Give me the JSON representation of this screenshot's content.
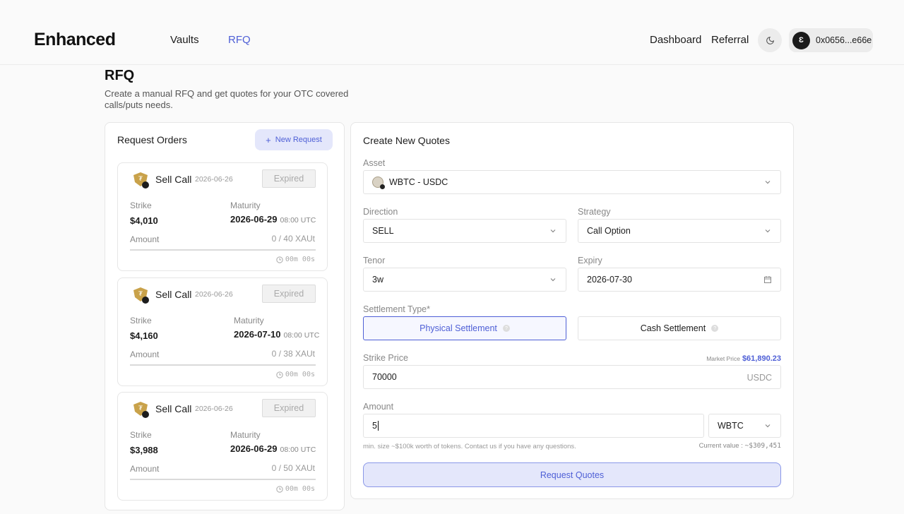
{
  "header": {
    "logo": "Enhanced",
    "nav": [
      "Vaults",
      "RFQ"
    ],
    "right_links": [
      "Dashboard",
      "Referral"
    ],
    "wallet": "0x0656...e66e",
    "accent": "#4e5fd6"
  },
  "page": {
    "title": "RFQ",
    "subtitle": "Create a manual RFQ and get quotes for your OTC covered calls/puts needs."
  },
  "orders": {
    "title": "Request Orders",
    "new_request": "New Request",
    "items": [
      {
        "title": "Sell Call",
        "date": "2026-06-26",
        "status": "Expired",
        "strike_label": "Strike",
        "strike": "$4,010",
        "maturity_label": "Maturity",
        "maturity": "2026-06-29",
        "maturity_time": "08:00 UTC",
        "amount_label": "Amount",
        "amount": "0 / 40 XAUt",
        "timer": "00m 00s"
      },
      {
        "title": "Sell Call",
        "date": "2026-06-26",
        "status": "Expired",
        "strike_label": "Strike",
        "strike": "$4,160",
        "maturity_label": "Maturity",
        "maturity": "2026-07-10",
        "maturity_time": "08:00 UTC",
        "amount_label": "Amount",
        "amount": "0 / 38 XAUt",
        "timer": "00m 00s"
      },
      {
        "title": "Sell Call",
        "date": "2026-06-26",
        "status": "Expired",
        "strike_label": "Strike",
        "strike": "$3,988",
        "maturity_label": "Maturity",
        "maturity": "2026-06-29",
        "maturity_time": "08:00 UTC",
        "amount_label": "Amount",
        "amount": "0 / 50 XAUt",
        "timer": "00m 00s"
      }
    ]
  },
  "form": {
    "title": "Create New Quotes",
    "asset_label": "Asset",
    "asset": "WBTC - USDC",
    "direction_label": "Direction",
    "direction": "SELL",
    "strategy_label": "Strategy",
    "strategy": "Call Option",
    "tenor_label": "Tenor",
    "tenor": "3w",
    "expiry_label": "Expiry",
    "expiry": "2026-07-30",
    "settlement_label": "Settlement Type*",
    "settlement_physical": "Physical Settlement",
    "settlement_cash": "Cash Settlement",
    "strike_label": "Strike Price",
    "market_price_label": "Market Price",
    "market_price": "$61,890.23",
    "strike_value": "70000",
    "strike_unit": "USDC",
    "amount_label": "Amount",
    "amount_value": "5",
    "amount_unit": "WBTC",
    "hint": "min. size ~$100k worth of tokens. Contact us if you have any questions.",
    "current_value_label": "Current value :",
    "current_value": "~$309,451",
    "submit": "Request Quotes"
  }
}
